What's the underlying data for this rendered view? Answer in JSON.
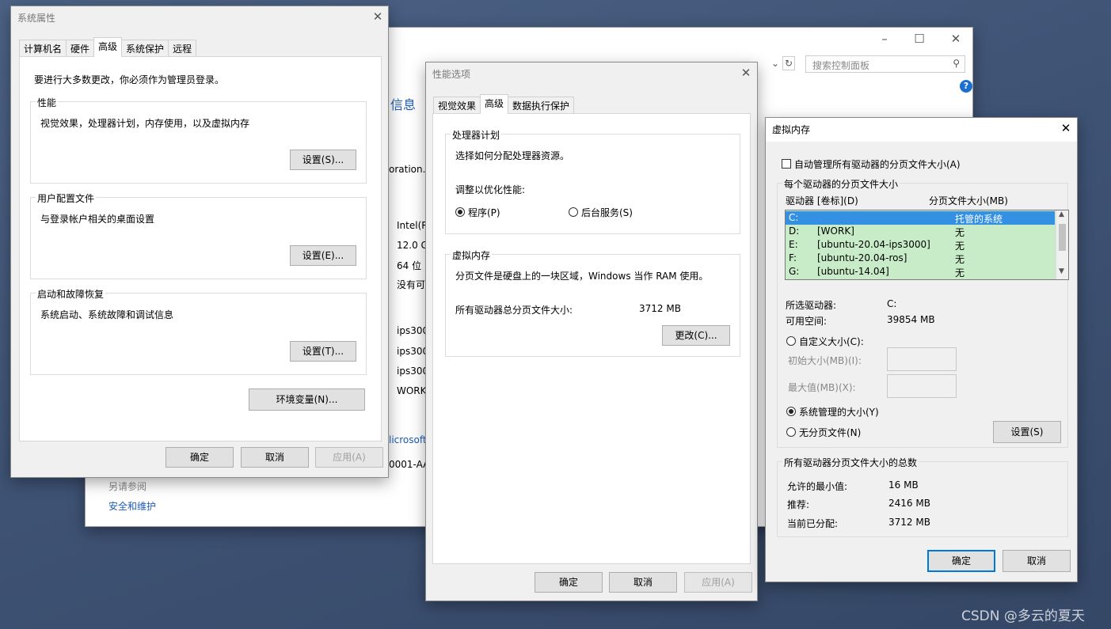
{
  "control_panel": {
    "search_placeholder": "搜索控制面板",
    "heading_fragment": "信息",
    "text_fragments": [
      "Intel(R",
      "12.0 G",
      "64 位",
      "没有可",
      "ips300",
      "ips300",
      "ips300",
      "WORK"
    ],
    "corp_fragment": "oration.",
    "ms_fragment": "licrosoft",
    "id_fragment": "0001-AA6",
    "see_also_label": "另请参阅",
    "security_link": "安全和维护"
  },
  "sys_props": {
    "title": "系统属性",
    "tabs": [
      "计算机名",
      "硬件",
      "高级",
      "系统保护",
      "远程"
    ],
    "admin_note": "要进行大多数更改，你必须作为管理员登录。",
    "perf": {
      "label": "性能",
      "desc": "视觉效果，处理器计划，内存使用，以及虚拟内存",
      "button": "设置(S)..."
    },
    "profile": {
      "label": "用户配置文件",
      "desc": "与登录帐户相关的桌面设置",
      "button": "设置(E)..."
    },
    "startup": {
      "label": "启动和故障恢复",
      "desc": "系统启动、系统故障和调试信息",
      "button": "设置(T)..."
    },
    "env_button": "环境变量(N)...",
    "ok": "确定",
    "cancel": "取消",
    "apply": "应用(A)"
  },
  "perf_opts": {
    "title": "性能选项",
    "tabs": [
      "视觉效果",
      "高级",
      "数据执行保护"
    ],
    "sched": {
      "label": "处理器计划",
      "desc": "选择如何分配处理器资源。",
      "adjust": "调整以优化性能:",
      "programs": "程序(P)",
      "background": "后台服务(S)"
    },
    "vm": {
      "label": "虚拟内存",
      "desc": "分页文件是硬盘上的一块区域，Windows 当作 RAM 使用。",
      "total_label": "所有驱动器总分页文件大小:",
      "total_value": "3712 MB",
      "change": "更改(C)..."
    },
    "ok": "确定",
    "cancel": "取消",
    "apply": "应用(A)"
  },
  "vmem": {
    "title": "虚拟内存",
    "auto_manage": "自动管理所有驱动器的分页文件大小(A)",
    "group_label": "每个驱动器的分页文件大小",
    "col_drive": "驱动器 [卷标](D)",
    "col_size": "分页文件大小(MB)",
    "rows": [
      {
        "drive": "C:",
        "label": "",
        "size": "托管的系统"
      },
      {
        "drive": "D:",
        "label": "[WORK]",
        "size": "无"
      },
      {
        "drive": "E:",
        "label": "[ubuntu-20.04-ips3000]",
        "size": "无"
      },
      {
        "drive": "F:",
        "label": "[ubuntu-20.04-ros]",
        "size": "无"
      },
      {
        "drive": "G:",
        "label": "[ubuntu-14.04]",
        "size": "无"
      }
    ],
    "selected_label": "所选驱动器:",
    "selected_value": "C:",
    "free_label": "可用空间:",
    "free_value": "39854 MB",
    "custom": "自定义大小(C):",
    "initial": "初始大小(MB)(I):",
    "max": "最大值(MB)(X):",
    "system_managed": "系统管理的大小(Y)",
    "no_paging": "无分页文件(N)",
    "set": "设置(S)",
    "totals_label": "所有驱动器分页文件大小的总数",
    "min_label": "允许的最小值:",
    "min_value": "16 MB",
    "rec_label": "推荐:",
    "rec_value": "2416 MB",
    "cur_label": "当前已分配:",
    "cur_value": "3712 MB",
    "ok": "确定",
    "cancel": "取消"
  },
  "watermark": "CSDN @多云的夏天"
}
